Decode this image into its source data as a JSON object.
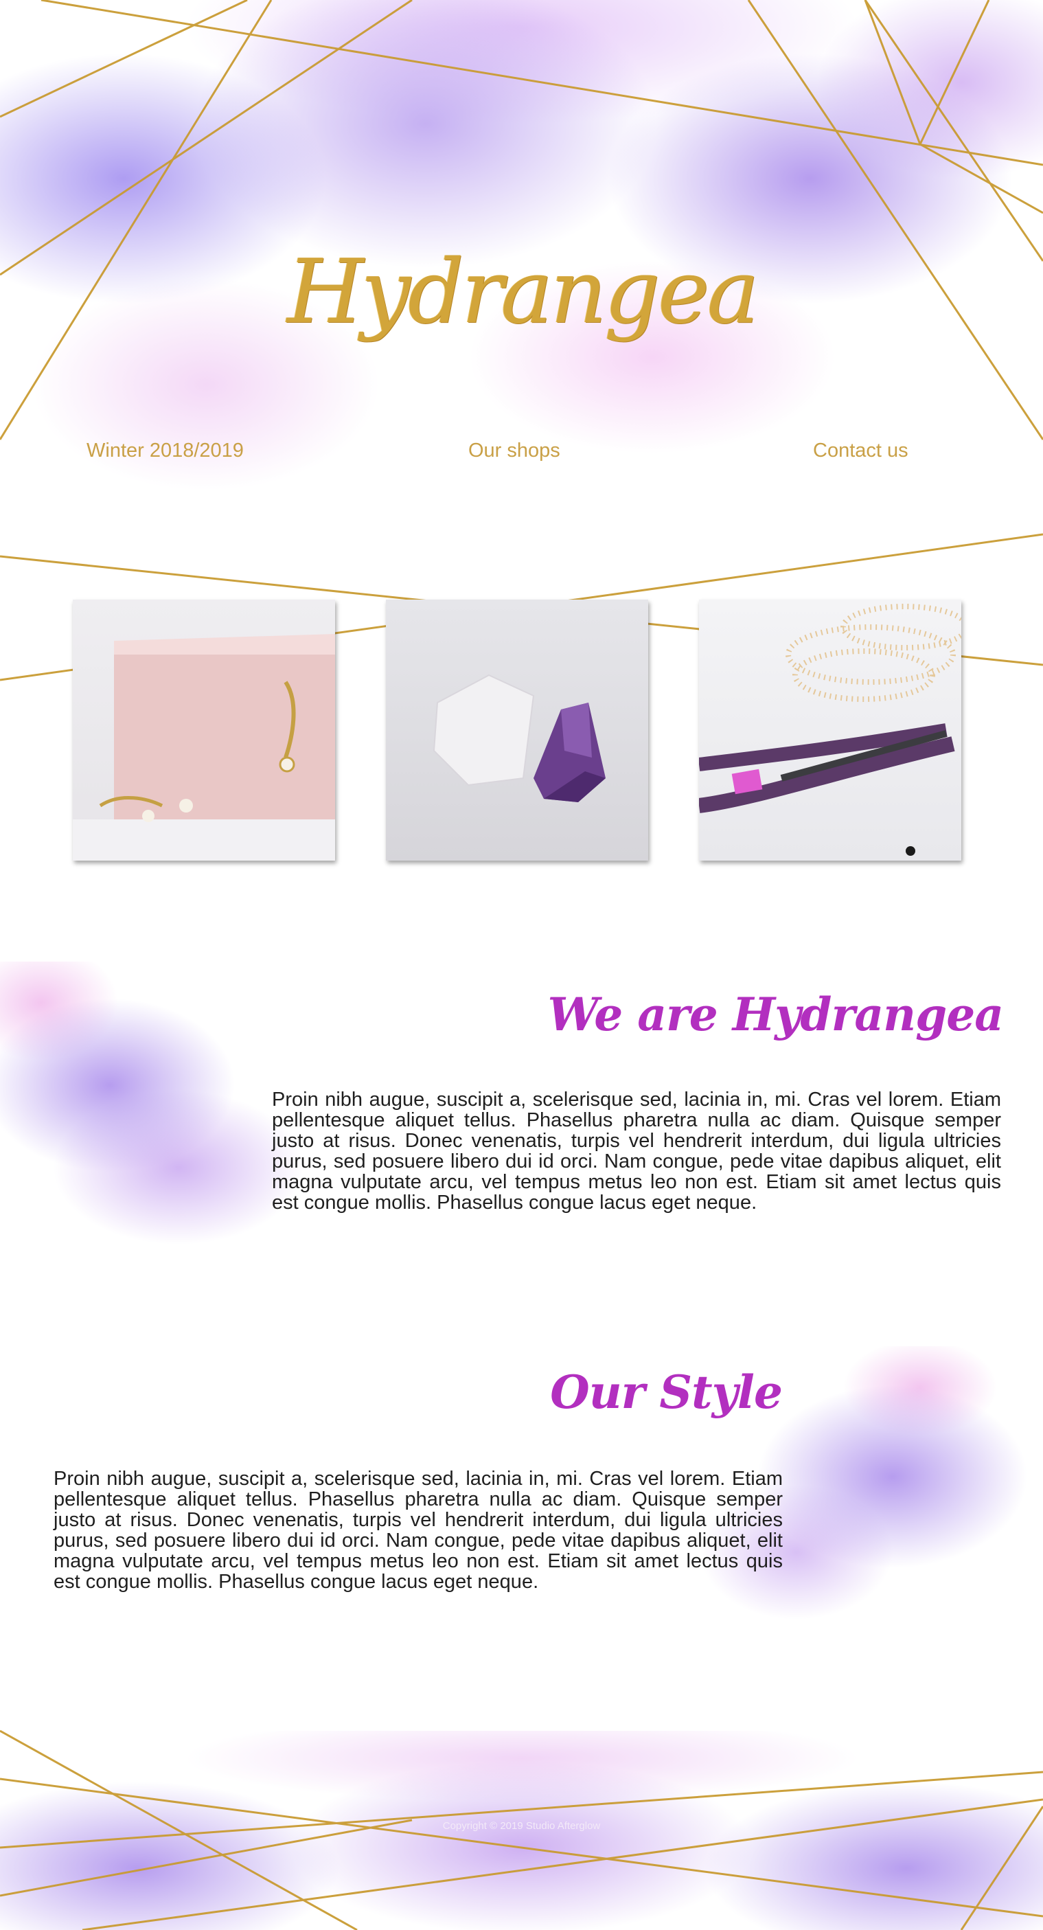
{
  "brand": {
    "name": "Hydrangea",
    "gold": "#d2a53a",
    "accent": "#b22fbf"
  },
  "nav": {
    "items": [
      {
        "label": "Winter 2018/2019"
      },
      {
        "label": "Our shops"
      },
      {
        "label": "Contact us"
      }
    ]
  },
  "gallery": {
    "photos": [
      {
        "icon": "jewelry-box-earrings-photo"
      },
      {
        "icon": "crystals-photo"
      },
      {
        "icon": "pearls-pliers-photo"
      }
    ]
  },
  "about": {
    "title": "We are Hydrangea",
    "text": "Proin nibh augue, suscipit a, scelerisque sed, lacinia in, mi. Cras vel lorem. Etiam pellentesque aliquet tellus. Phasellus pharetra nulla ac diam. Quisque semper justo at risus. Donec venenatis, turpis vel hendrerit interdum, dui ligula ultricies purus, sed posuere libero dui id orci. Nam congue, pede vitae dapibus aliquet, elit magna vulputate arcu, vel tempus metus leo non est. Etiam sit amet lectus quis est congue mollis. Phasellus congue lacus eget neque."
  },
  "style": {
    "title": "Our Style",
    "text": "Proin nibh augue, suscipit a, scelerisque sed, lacinia in, mi. Cras vel lorem. Etiam pellentesque aliquet tellus. Phasellus pharetra nulla ac diam. Quisque semper justo at risus. Donec venenatis, turpis vel hendrerit interdum, dui ligula ultricies purus, sed posuere libero dui id orci. Nam congue, pede vitae dapibus aliquet, elit magna vulputate arcu, vel tempus metus leo non est. Etiam sit amet lectus quis est congue mollis. Phasellus congue lacus eget neque."
  },
  "footer": {
    "copyright": "Copyright © 2019 Studio Afterglow"
  }
}
